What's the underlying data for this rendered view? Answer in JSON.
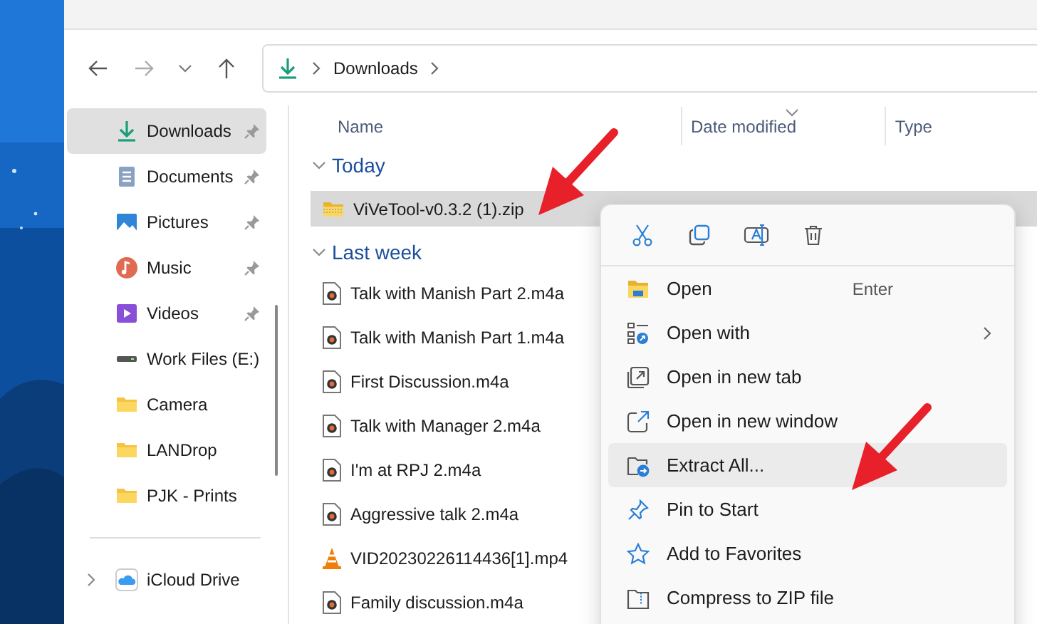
{
  "address_bar": {
    "crumbs": [
      "Downloads"
    ]
  },
  "sidebar": {
    "items": [
      {
        "label": "Downloads",
        "kind": "downloads",
        "pinned": true,
        "selected": true,
        "expandable": false
      },
      {
        "label": "Documents",
        "kind": "documents",
        "pinned": true,
        "selected": false,
        "expandable": false
      },
      {
        "label": "Pictures",
        "kind": "pictures",
        "pinned": true,
        "selected": false,
        "expandable": false
      },
      {
        "label": "Music",
        "kind": "music",
        "pinned": true,
        "selected": false,
        "expandable": false
      },
      {
        "label": "Videos",
        "kind": "videos",
        "pinned": true,
        "selected": false,
        "expandable": false
      },
      {
        "label": "Work Files (E:)",
        "kind": "drive",
        "pinned": false,
        "selected": false,
        "expandable": false
      },
      {
        "label": "Camera",
        "kind": "folder",
        "pinned": false,
        "selected": false,
        "expandable": false
      },
      {
        "label": "LANDrop",
        "kind": "folder",
        "pinned": false,
        "selected": false,
        "expandable": false
      },
      {
        "label": "PJK - Prints",
        "kind": "folder",
        "pinned": false,
        "selected": false,
        "expandable": false
      },
      {
        "label": "iCloud Drive",
        "kind": "cloud",
        "pinned": false,
        "selected": false,
        "expandable": true
      }
    ]
  },
  "table": {
    "columns": [
      {
        "label": "Name",
        "sorted": false
      },
      {
        "label": "Date modified",
        "sorted": true
      },
      {
        "label": "Type",
        "sorted": false
      }
    ],
    "groups": [
      {
        "label": "Today",
        "expanded": true,
        "files": [
          {
            "name": "ViVeTool-v0.3.2 (1).zip",
            "kind": "zip",
            "selected": true
          }
        ]
      },
      {
        "label": "Last week",
        "expanded": true,
        "files": [
          {
            "name": "Talk with Manish Part 2.m4a",
            "kind": "audio",
            "selected": false
          },
          {
            "name": "Talk with Manish Part 1.m4a",
            "kind": "audio",
            "selected": false
          },
          {
            "name": "First Discussion.m4a",
            "kind": "audio",
            "selected": false
          },
          {
            "name": "Talk with Manager 2.m4a",
            "kind": "audio",
            "selected": false
          },
          {
            "name": "I'm at RPJ 2.m4a",
            "kind": "audio",
            "selected": false
          },
          {
            "name": "Aggressive talk 2.m4a",
            "kind": "audio",
            "selected": false
          },
          {
            "name": "VID20230226114436[1].mp4",
            "kind": "video",
            "selected": false
          },
          {
            "name": "Family discussion.m4a",
            "kind": "audio",
            "selected": false
          }
        ]
      }
    ]
  },
  "context_menu": {
    "toolbar": [
      {
        "kind": "cut"
      },
      {
        "kind": "copy"
      },
      {
        "kind": "rename"
      },
      {
        "kind": "delete"
      }
    ],
    "items": [
      {
        "label": "Open",
        "kind": "open",
        "shortcut": "Enter",
        "submenu": false,
        "selected": false
      },
      {
        "label": "Open with",
        "kind": "open_with",
        "submenu": true,
        "selected": false
      },
      {
        "label": "Open in new tab",
        "kind": "new_tab",
        "submenu": false,
        "selected": false
      },
      {
        "label": "Open in new window",
        "kind": "new_window",
        "submenu": false,
        "selected": false
      },
      {
        "label": "Extract All...",
        "kind": "extract",
        "submenu": false,
        "selected": true
      },
      {
        "label": "Pin to Start",
        "kind": "pin",
        "submenu": false,
        "selected": false
      },
      {
        "label": "Add to Favorites",
        "kind": "star",
        "submenu": false,
        "selected": false
      },
      {
        "label": "Compress to ZIP file",
        "kind": "compress",
        "submenu": false,
        "selected": false
      }
    ]
  },
  "annotations": [
    {
      "kind": "arrow"
    },
    {
      "kind": "arrow"
    }
  ]
}
